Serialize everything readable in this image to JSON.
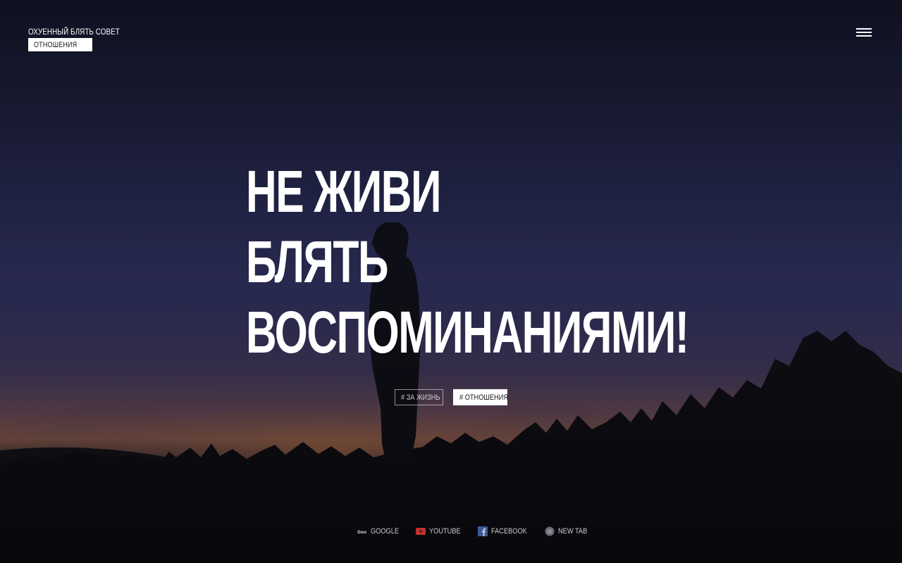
{
  "brand": {
    "title": "ОХУЕННЫЙ БЛЯТЬ СОВЕТ",
    "category": "ОТНОШЕНИЯ"
  },
  "menu": {
    "icon": "hamburger-menu-icon"
  },
  "headline": {
    "lines": [
      "НЕ ЖИВИ",
      "БЛЯТЬ",
      "ВОСПОМИНАНИЯМИ!"
    ]
  },
  "tags": [
    {
      "label": "# ЗА ЖИЗНЬ",
      "active": false
    },
    {
      "label": "# ОТНОШЕНИЯ",
      "active": true
    }
  ],
  "bookmarks": [
    {
      "label": "GOOGLE",
      "icon": "google-icon"
    },
    {
      "label": "YOUTUBE",
      "icon": "youtube-icon",
      "color": "#c4302b"
    },
    {
      "label": "FACEBOOK",
      "icon": "facebook-icon",
      "color": "#3b5998"
    },
    {
      "label": "NEW TAB",
      "icon": "globe-icon"
    }
  ],
  "colors": {
    "text": "#ffffff",
    "tag_text_dark": "#1a1a1a",
    "sky_top": "#14172a",
    "horizon_glow": "#7c5245"
  }
}
